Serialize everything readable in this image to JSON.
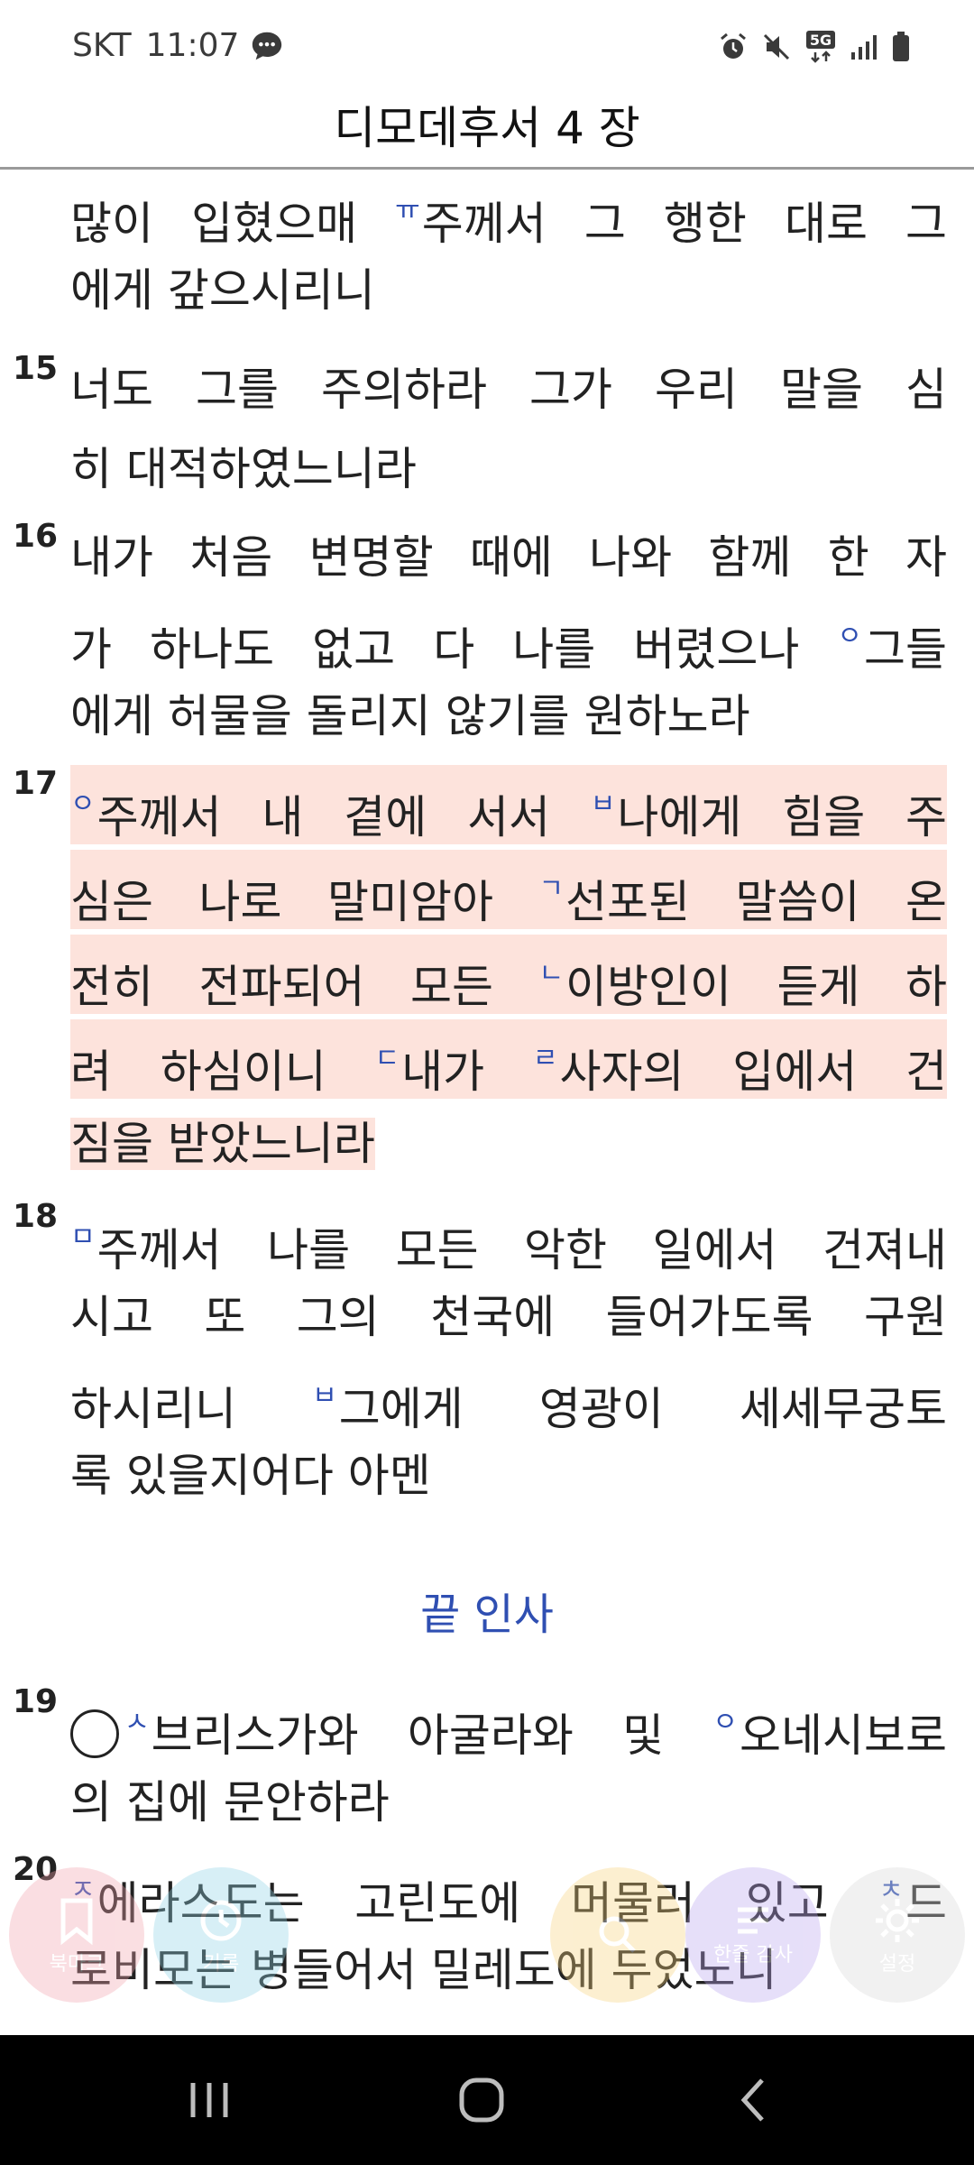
{
  "status_bar": {
    "carrier": "SKT",
    "time": "11:07",
    "network": "5G",
    "icons": [
      "chat-bubble-icon",
      "alarm-icon",
      "mute-icon",
      "5g-icon",
      "signal-icon",
      "battery-icon"
    ]
  },
  "header": {
    "title": "디모데후서 4 장"
  },
  "colors": {
    "highlight": "#fde3dc",
    "marker": "#2f4fb2",
    "heading": "#2f4fb2"
  },
  "verses": [
    {
      "number": "",
      "lines": [
        [
          {
            "m": "ㅠ",
            "t": "",
            "pre": "많이 입혔으매 "
          },
          {
            "t": "주께서 그 행한 대로 그"
          }
        ],
        [
          {
            "t": "에게 갚으시리니"
          }
        ]
      ]
    },
    {
      "number": "15",
      "lines": [
        [
          {
            "t": "너도 그를 주의하라 그가 우리 말을 심"
          }
        ],
        [
          {
            "t": "히 대적하였느니라"
          }
        ]
      ]
    },
    {
      "number": "16",
      "lines": [
        [
          {
            "t": "내가 처음 변명할 때에 나와 함께 한 자"
          }
        ],
        [
          {
            "pre": "가 하나도 없고 다 나를 버렸으나 ",
            "m": "ㅇ",
            "t": "그들"
          }
        ],
        [
          {
            "t": "에게 허물을 돌리지 않기를 원하노라"
          }
        ]
      ]
    },
    {
      "number": "17",
      "highlight": true,
      "lines": [
        [
          {
            "m": "ㅇ",
            "t": "주께서 내 곁에 서서 "
          },
          {
            "m": "ㅂ",
            "t": "나에게 힘을 주"
          }
        ],
        [
          {
            "pre": "심은 나로 말미암아 ",
            "m": "ㄱ",
            "t": "선포된 말씀이 온"
          }
        ],
        [
          {
            "pre": "전히 전파되어 모든 ",
            "m": "ㄴ",
            "t": "이방인이 듣게 하"
          }
        ],
        [
          {
            "pre": "려 하심이니 ",
            "m": "ㄷ",
            "t": "내가 "
          },
          {
            "m": "ㄹ",
            "t": "사자의 입에서 건"
          }
        ],
        [
          {
            "t": "짐을 받았느니라"
          }
        ]
      ]
    },
    {
      "number": "18",
      "lines": [
        [
          {
            "m": "ㅁ",
            "t": "주께서 나를 모든 악한 일에서 건져내"
          }
        ],
        [
          {
            "t": "시고 또 그의 천국에 들어가도록 구원"
          }
        ],
        [
          {
            "pre": "하시리니 ",
            "m": "ㅂ",
            "t": "그에게 영광이 세세무궁토"
          }
        ],
        [
          {
            "t": "록 있을지어다 아멘"
          }
        ]
      ]
    },
    {
      "number": "19",
      "lines": [
        [
          {
            "circle": true,
            "m": "ㅅ",
            "t": "브리스가와 아굴라와 및 "
          },
          {
            "m": "ㅇ",
            "t": "오네시보로"
          }
        ],
        [
          {
            "t": "의 집에 문안하라"
          }
        ]
      ]
    },
    {
      "number": "20",
      "lines": [
        [
          {
            "m": "ㅈ",
            "t": "에라스도는 고린도에 머물러 있고 "
          },
          {
            "m": "ㅊ",
            "t": "드"
          }
        ],
        [
          {
            "t": "로비모는 병들어서 밀레도에 두었노니"
          }
        ]
      ]
    }
  ],
  "section_heading": "끝 인사",
  "floating_toolbar": [
    {
      "label": "북마크",
      "icon": "bookmark-icon",
      "color": "#f2a3ad"
    },
    {
      "label": "기록",
      "icon": "history-icon",
      "color": "#8fd3e6"
    },
    {
      "label": "",
      "icon": "search-icon",
      "color": "#f7d27a"
    },
    {
      "label": "한줄 감사",
      "icon": "note-icon",
      "color": "#b9a4ef"
    },
    {
      "label": "설정",
      "icon": "gear-icon",
      "color": "#d8d8d8"
    }
  ],
  "nav_bar": {
    "buttons": [
      "recent-apps-icon",
      "home-icon",
      "back-icon"
    ]
  }
}
